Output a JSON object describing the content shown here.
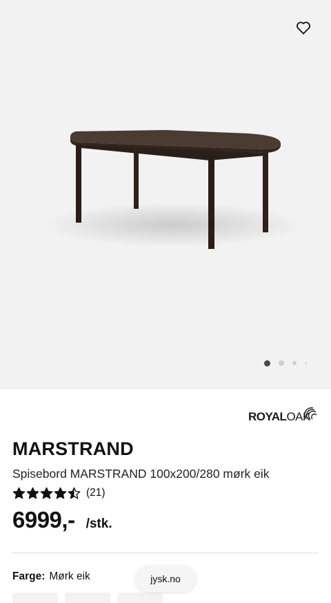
{
  "product": {
    "brand_logo_text": "ROYALOAK",
    "brand_logo_bold": "ROYAL",
    "brand_logo_light": "OAK",
    "title": "MARSTRAND",
    "subtitle": "Spisebord MARSTRAND 100x200/280 mørk eik",
    "rating_value": 4.5,
    "rating_count": "(21)",
    "price": "6999,-",
    "unit": "/stk.",
    "color_label": "Farge:",
    "color_value": "Mørk eik"
  },
  "gallery": {
    "total_images": 4,
    "active_index": 0
  },
  "browser": {
    "url": "jysk.no"
  },
  "colors": {
    "hero_bg": "#f2f2f2",
    "dot_active": "#4a4a4a",
    "dot_inactive": "#cfcfcf"
  }
}
